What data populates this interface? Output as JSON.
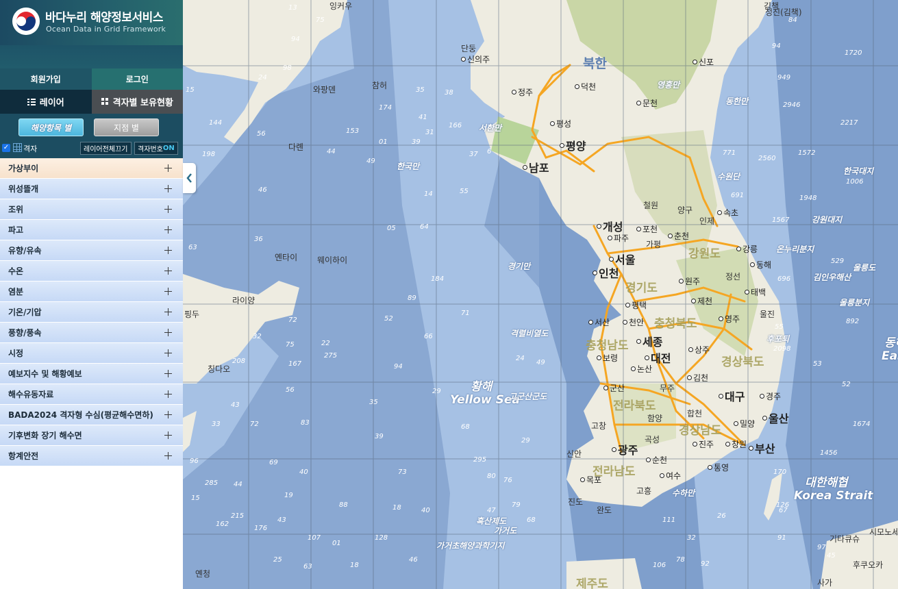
{
  "header": {
    "title": "바다누리 해양정보서비스",
    "subtitle": "Ocean Data in Grid Framework"
  },
  "auth": {
    "join": "회원가입",
    "login": "로그인"
  },
  "tabs": {
    "layer": "레이어",
    "grid_holdings": "격자별 보유현황"
  },
  "filters": {
    "by_sea_item": "해양항목 별",
    "by_point": "지점 별"
  },
  "grid_toggle": {
    "label": "격자",
    "checked": true,
    "layers_off": "레이어전체끄기",
    "grid_number_prefix": "격자번호",
    "grid_number_state": "ON"
  },
  "menu": [
    "가상부이",
    "위성뜰개",
    "조위",
    "파고",
    "유향/유속",
    "수온",
    "염분",
    "기온/기압",
    "풍향/풍속",
    "시정",
    "예보지수 및 해황예보",
    "해수유동자료",
    "BADA2024 격자형 수심(평균해수면하)",
    "기후변화 장기 해수면",
    "항계안전"
  ],
  "colors": {
    "header": "#1c4a62",
    "active_tab": "#0f2c3c",
    "sea_deep": "#7f9fcc",
    "sea_shallow": "#a6c1e4",
    "land": "#eeece1",
    "road": "#f5a623"
  },
  "map": {
    "north_korea": "북한",
    "cities": {
      "big": [
        "평양",
        "남포",
        "개성",
        "서울",
        "인천",
        "세종",
        "대전",
        "대구",
        "울산",
        "부산",
        "광주"
      ],
      "small": [
        "신의주",
        "정주",
        "덕천",
        "문천",
        "평성",
        "신포",
        "철원",
        "양구",
        "인제",
        "속초",
        "포천",
        "춘천",
        "파주",
        "가평",
        "강릉",
        "동해",
        "원주",
        "정선",
        "태백",
        "제천",
        "평택",
        "서산",
        "천안",
        "영주",
        "울진",
        "보령",
        "상주",
        "논산",
        "김천",
        "군산",
        "무주",
        "경주",
        "고창",
        "함양",
        "합천",
        "밀양",
        "곡성",
        "진주",
        "창원",
        "신안",
        "순천",
        "목포",
        "여수",
        "통영",
        "고흥",
        "진도",
        "완도",
        "청진(김책)",
        "단둥",
        "참허",
        "와팡뎬",
        "다롄",
        "라이양",
        "칭다오",
        "옌타이",
        "웨이하이",
        "잉커우",
        "핑두",
        "옌청",
        "기타큐슈",
        "시모노세키",
        "후쿠오카",
        "사가",
        "김책"
      ]
    },
    "provinces": [
      "강원도",
      "경기도",
      "충청북도",
      "충청남도",
      "경상북도",
      "전라북도",
      "경상남도",
      "전라남도",
      "제주도"
    ],
    "seas": [
      "서한만",
      "한국만",
      "경기만",
      "격렬비열도",
      "황해",
      "Yellow Sea",
      "고군산군도",
      "흑산제도",
      "가거도",
      "가거초해양과학기지",
      "동한만",
      "수원단",
      "한국대지",
      "강원대지",
      "온누리분지",
      "김인우해산",
      "울릉분지",
      "후포퇴",
      "대한해협",
      "Korea Strait",
      "울릉도",
      "동해",
      "East",
      "영흥만",
      "수하만"
    ],
    "depths": [
      "13",
      "75",
      "94",
      "98",
      "24",
      "15",
      "144",
      "56",
      "198",
      "46",
      "35",
      "38",
      "174",
      "41",
      "31",
      "166",
      "153",
      "01",
      "39",
      "44",
      "49",
      "37",
      "6",
      "14",
      "55",
      "36",
      "05",
      "184",
      "64",
      "63",
      "89",
      "52",
      "71",
      "66",
      "72",
      "75",
      "22",
      "275",
      "167",
      "208",
      "32",
      "94",
      "24",
      "49",
      "56",
      "43",
      "35",
      "29",
      "68",
      "72",
      "83",
      "33",
      "39",
      "29",
      "69",
      "40",
      "285",
      "44",
      "96",
      "19",
      "215",
      "176",
      "15",
      "162",
      "43",
      "88",
      "18",
      "40",
      "73",
      "80",
      "76",
      "47",
      "295",
      "68",
      "79",
      "107",
      "01",
      "128",
      "18",
      "46",
      "25",
      "63",
      "84",
      "94",
      "1720",
      "949",
      "2946",
      "2217",
      "771",
      "2560",
      "1572",
      "1006",
      "691",
      "1948",
      "1567",
      "529",
      "696",
      "892",
      "55",
      "2098",
      "53",
      "52",
      "1674",
      "1456",
      "170",
      "126",
      "67",
      "91",
      "97",
      "45",
      "26",
      "32",
      "78",
      "92",
      "111",
      "106",
      "36",
      "98"
    ]
  }
}
